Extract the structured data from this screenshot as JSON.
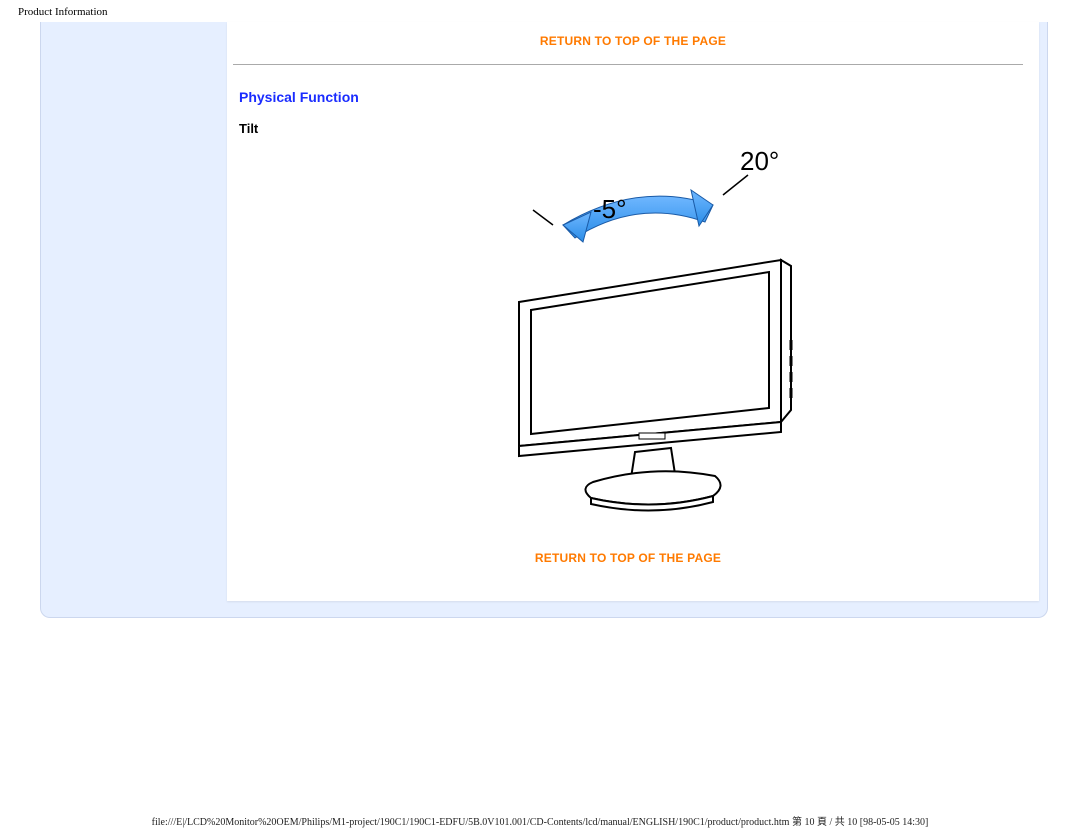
{
  "page_header": "Product Information",
  "links": {
    "return_top": "RETURN TO TOP OF THE PAGE"
  },
  "section": {
    "title": "Physical Function",
    "sub": "Tilt"
  },
  "tilt": {
    "angle_back_label": "20°",
    "angle_forward_label": "-5°"
  },
  "footer": "file:///E|/LCD%20Monitor%20OEM/Philips/M1-project/190C1/190C1-EDFU/5B.0V101.001/CD-Contents/lcd/manual/ENGLISH/190C1/product/product.htm 第 10 頁 / 共 10  [98-05-05 14:30]"
}
